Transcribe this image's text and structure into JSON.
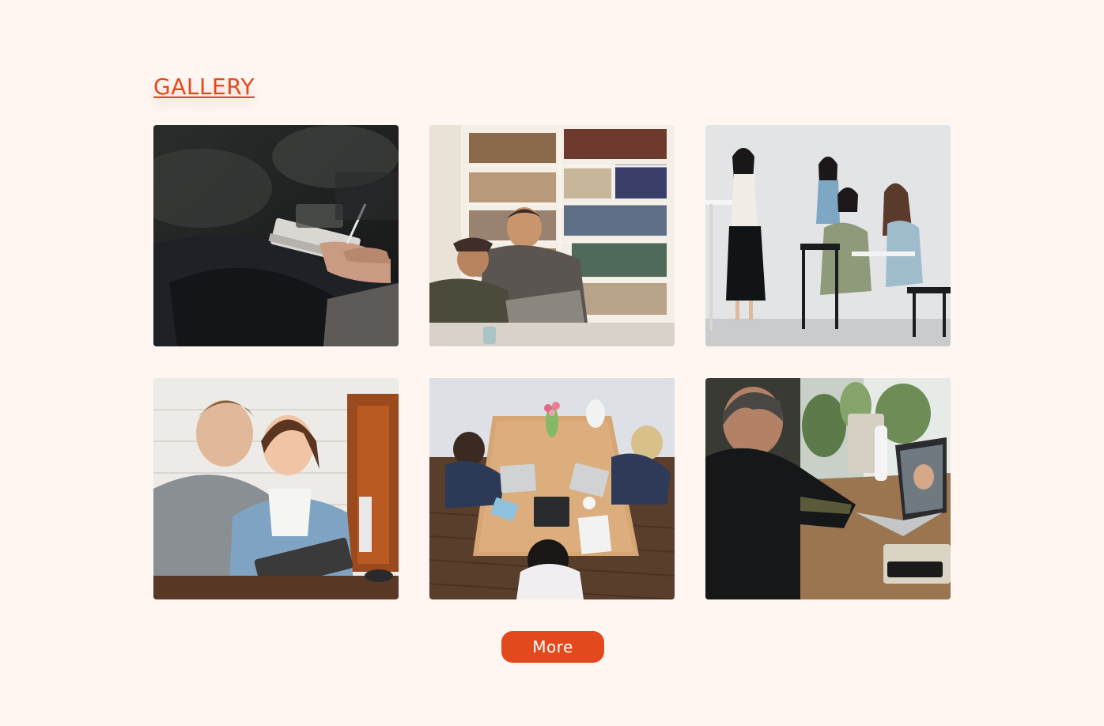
{
  "colors": {
    "accent": "#e24a1d",
    "background": "#fff6f2"
  },
  "gallery": {
    "title": "GALLERY",
    "photos": [
      {
        "name": "photo-notebook-writing-icon"
      },
      {
        "name": "photo-library-laughing-icon"
      },
      {
        "name": "photo-women-standing-table-icon"
      },
      {
        "name": "photo-two-colleagues-tablet-icon"
      },
      {
        "name": "photo-overhead-meeting-table-icon"
      },
      {
        "name": "photo-video-call-laptop-icon"
      }
    ]
  },
  "actions": {
    "more_label": "More"
  }
}
